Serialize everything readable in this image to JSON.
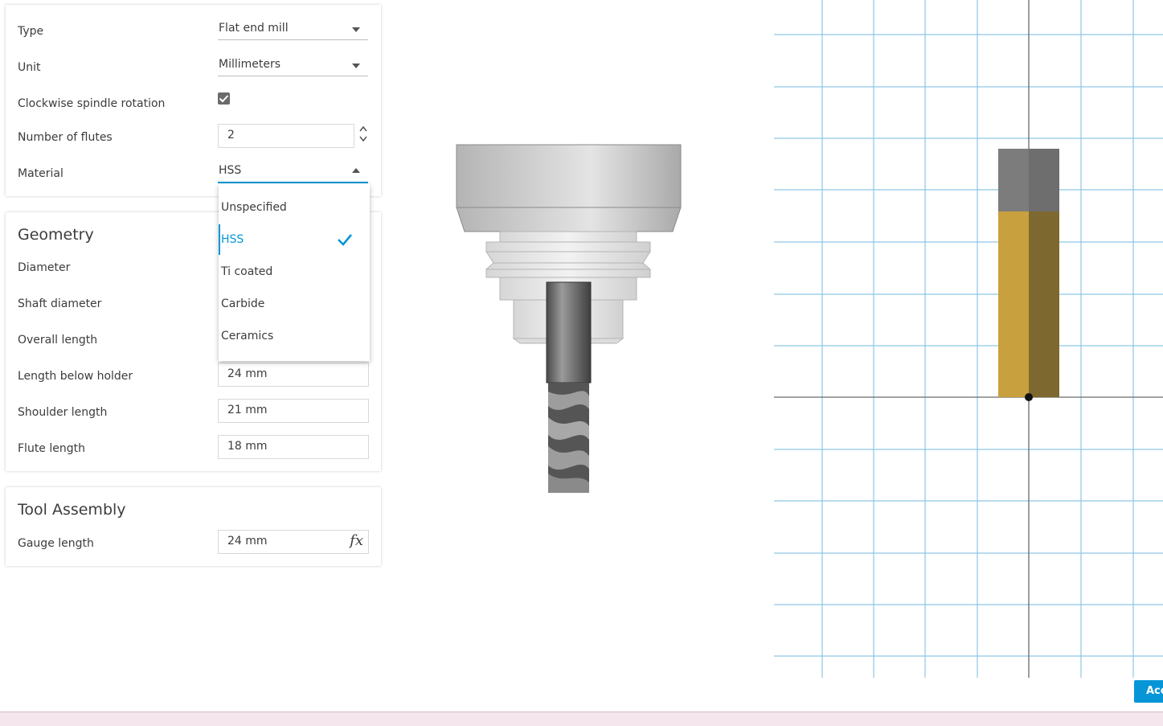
{
  "general": {
    "type_label": "Type",
    "type_value": "Flat end mill",
    "unit_label": "Unit",
    "unit_value": "Millimeters",
    "spindle_label": "Clockwise spindle rotation",
    "spindle_checked": true,
    "flutes_label": "Number of flutes",
    "flutes_value": "2",
    "material_label": "Material",
    "material_value": "HSS"
  },
  "material_dropdown": {
    "options": [
      "Unspecified",
      "HSS",
      "Ti coated",
      "Carbide",
      "Ceramics"
    ],
    "selected": "HSS"
  },
  "geometry": {
    "title": "Geometry",
    "diameter_label": "Diameter",
    "shaft_diameter_label": "Shaft diameter",
    "overall_length_label": "Overall length",
    "length_below_holder_label": "Length below holder",
    "length_below_holder_value": "24 mm",
    "shoulder_length_label": "Shoulder length",
    "shoulder_length_value": "21 mm",
    "flute_length_label": "Flute length",
    "flute_length_value": "18 mm"
  },
  "tool_assembly": {
    "title": "Tool Assembly",
    "gauge_length_label": "Gauge length",
    "gauge_length_value": "24 mm",
    "formula_icon": "fx"
  },
  "footer": {
    "accept_label": "Acc"
  },
  "colors": {
    "accent": "#0696d7",
    "tool_body": "#c9a03e",
    "tool_shank": "#6e6e6e",
    "grid_line": "#8fc6e6"
  }
}
